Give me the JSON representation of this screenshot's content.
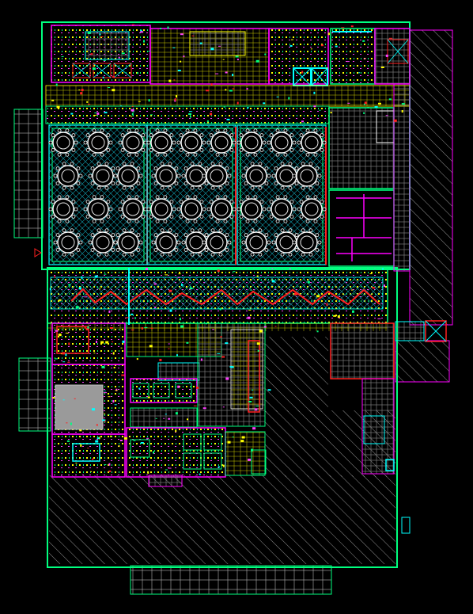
{
  "drawing": {
    "background": "#000000",
    "colors": {
      "wall": "#00ff7f",
      "magenta": "#ff00ff",
      "yellow": "#ffff00",
      "cyan": "#00ffff",
      "red": "#ff2020",
      "white": "#e8e8e8",
      "grid": "#9a9a9a",
      "hatch": "#c0c0c0",
      "mesh": "#0fa8b8"
    }
  }
}
